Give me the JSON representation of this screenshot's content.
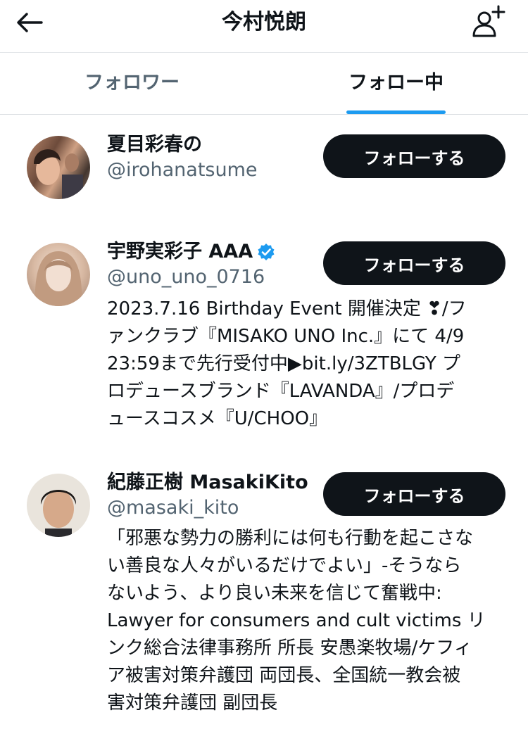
{
  "header": {
    "title": "今村悦朗",
    "back_icon": "arrow-left-icon",
    "add_icon": "add-person-icon"
  },
  "tabs": [
    {
      "label": "フォロワー"
    },
    {
      "label": "フォロー中"
    }
  ],
  "colors": {
    "accent": "#1d9bf0",
    "button_bg": "#0f1419",
    "secondary_text": "#536471"
  },
  "users": [
    {
      "name": "夏目彩春の",
      "handle": "@irohanatsume",
      "button": "フォローする",
      "bio": ""
    },
    {
      "name": "宇野実彩子 AAA",
      "handle": "@uno_uno_0716",
      "button": "フォローする",
      "verified": true,
      "bio_lines": [
        "2023.7.16 Birthday Event 開催決定 ❣/フ",
        "ァンクラブ『MISAKO UNO Inc.』にて 4/9",
        "23:59まで先行受付中▶bit.ly/3ZTBLGY プ",
        "ロデュースブランド『LAVANDA』/プロデ",
        "ュースコスメ『U/CHOO』"
      ]
    },
    {
      "name": "紀藤正樹 MasakiKito",
      "handle": "@masaki_kito",
      "button": "フォローする",
      "bio_lines": [
        "「邪悪な勢力の勝利には何も行動を起こさな",
        "い善良な人々がいるだけでよい」-そうなら",
        "ないよう、より良い未来を信じて奮戦中:",
        "Lawyer for consumers and cult victims リ",
        "ンク総合法律事務所 所長 安愚楽牧場/ケフィ",
        "ア被害対策弁護団 両団長、全国統一教会被",
        "害対策弁護団 副団長"
      ]
    }
  ]
}
